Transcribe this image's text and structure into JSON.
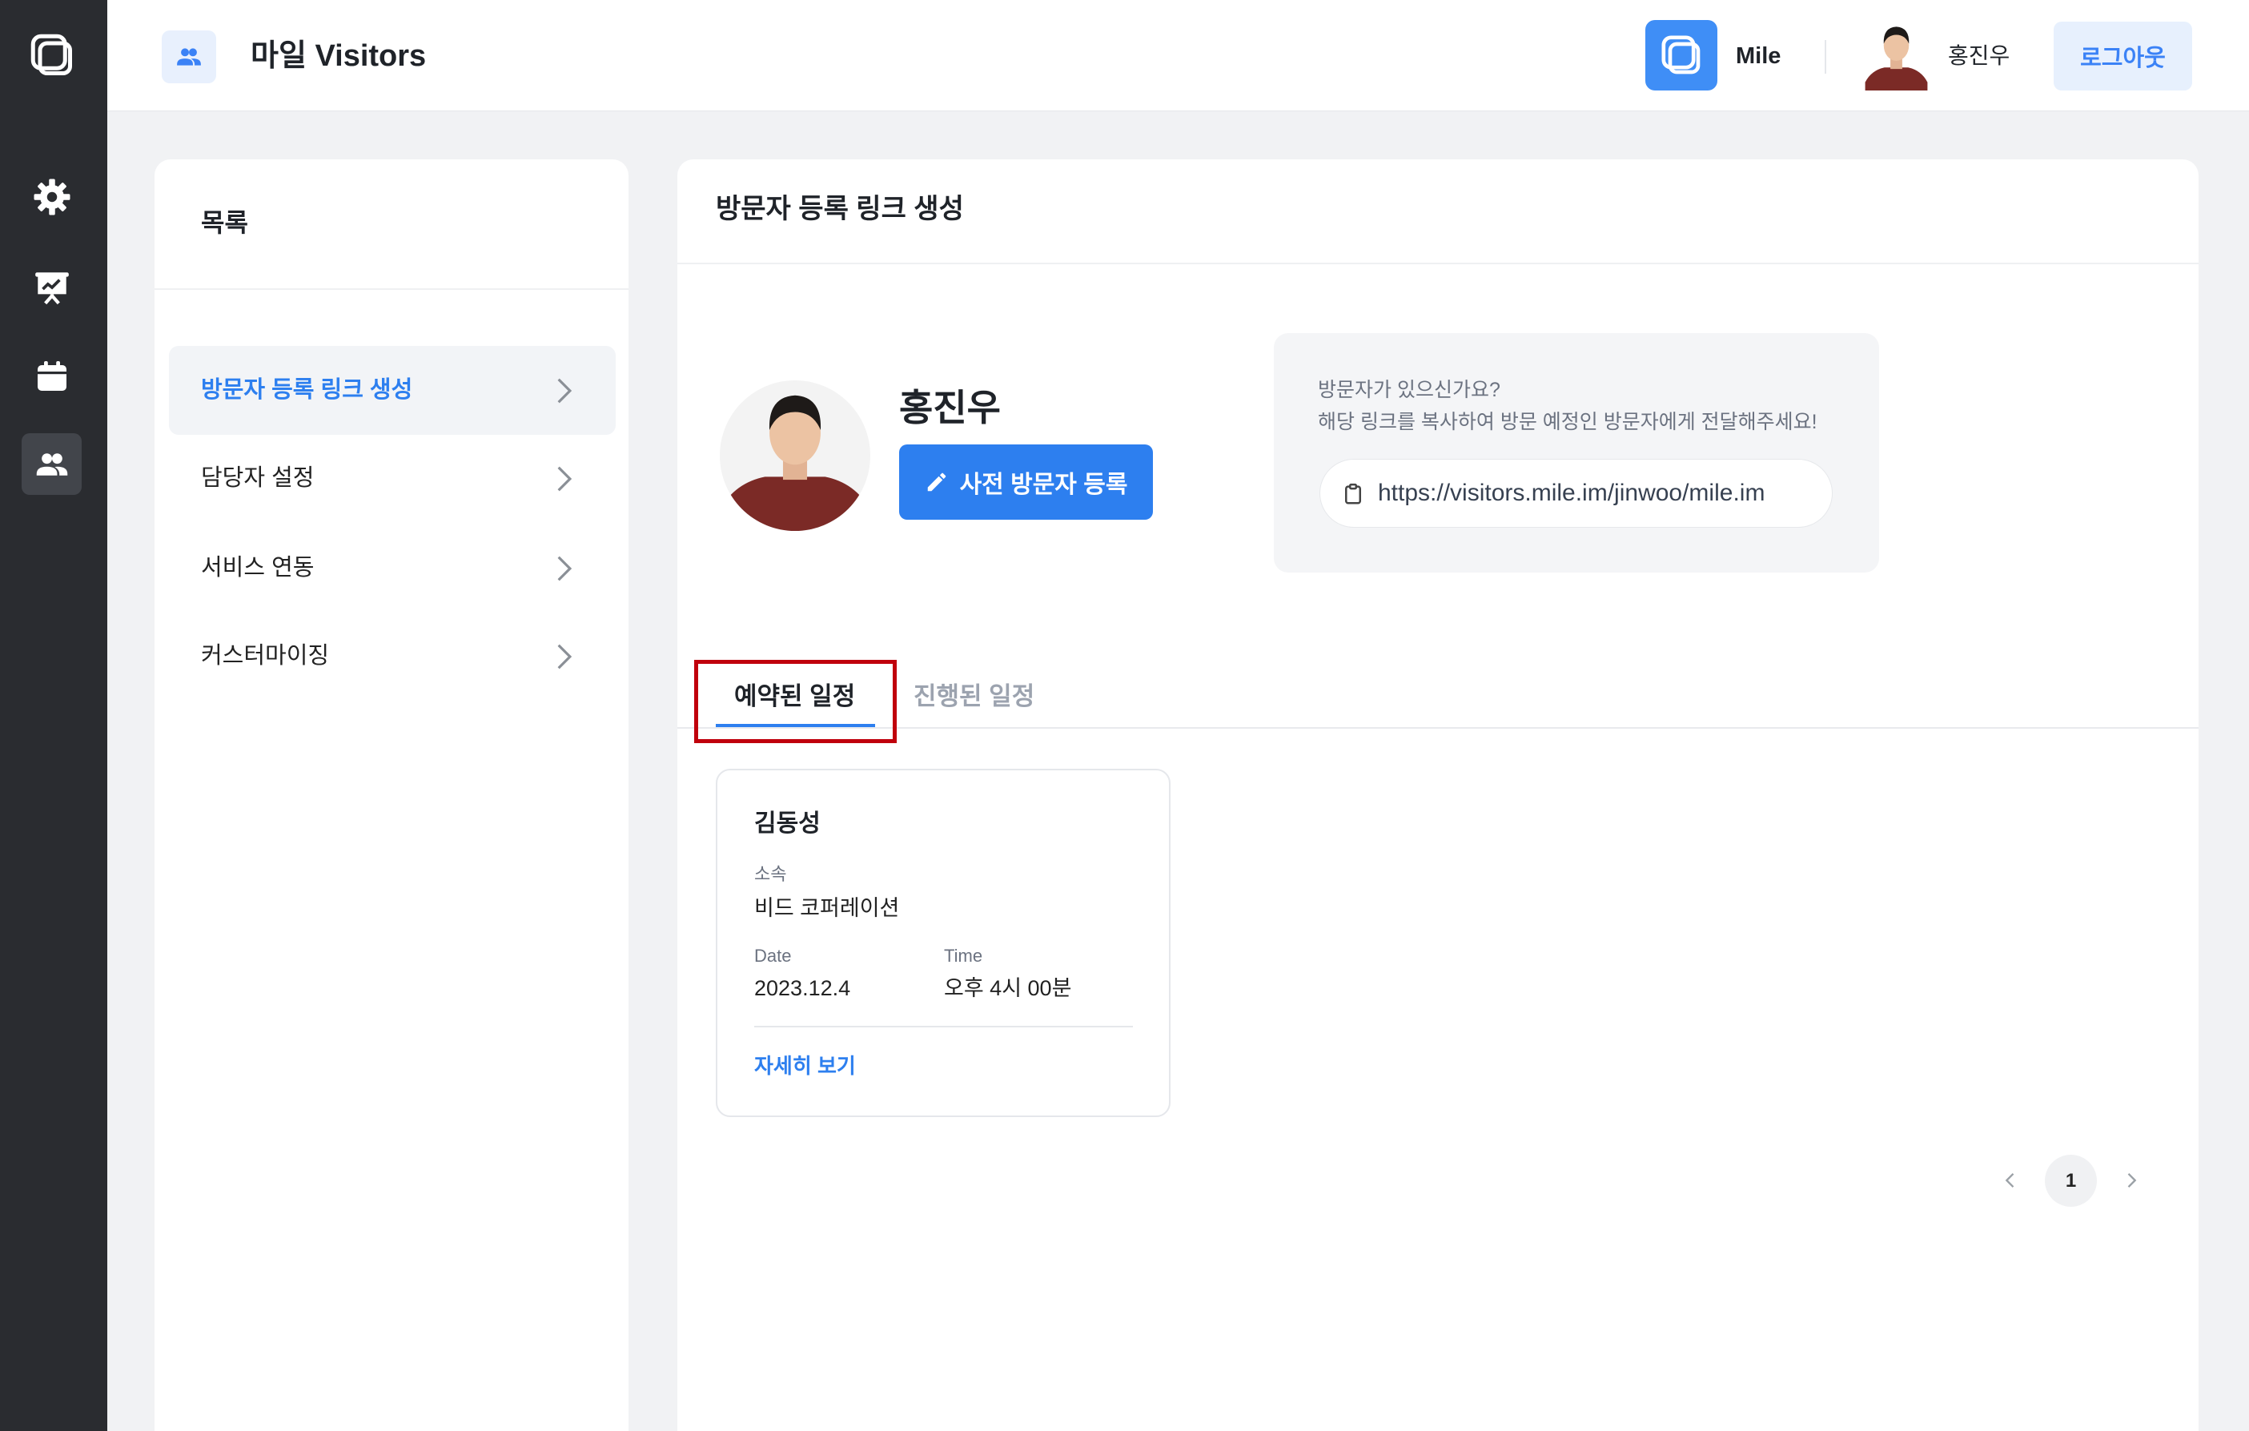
{
  "colors": {
    "accent": "#2d7fef",
    "rail_background": "#2a2c30",
    "page_background": "#f1f2f4",
    "annotation_border": "#c0000c"
  },
  "rail": {
    "items": [
      {
        "icon": "logo-icon"
      },
      {
        "icon": "gear-icon"
      },
      {
        "icon": "presentation-icon"
      },
      {
        "icon": "calendar-icon"
      },
      {
        "icon": "users-icon",
        "active": true
      }
    ]
  },
  "header": {
    "app_icon": "users-icon",
    "title": "마일 Visitors",
    "brand_name": "Mile",
    "user_name": "홍진우",
    "logout_label": "로그아웃"
  },
  "menu": {
    "title": "목록",
    "items": [
      {
        "label": "방문자 등록 링크 생성",
        "active": true,
        "icon": "chevron-right-icon"
      },
      {
        "label": "담당자 설정",
        "active": false,
        "icon": "chevron-right-icon"
      },
      {
        "label": "서비스 연동",
        "active": false,
        "icon": "chevron-right-icon"
      },
      {
        "label": "커스터마이징",
        "active": false,
        "icon": "chevron-right-icon"
      }
    ]
  },
  "main": {
    "title": "방문자 등록 링크 생성",
    "profile": {
      "name": "홍진우",
      "register_button": "사전 방문자 등록",
      "register_icon": "pencil-icon"
    },
    "invite": {
      "question": "방문자가 있으신가요?",
      "instruction": "해당 링크를 복사하여 방문 예정인 방문자에게 전달해주세요!",
      "link_icon": "clipboard-icon",
      "link": "https://visitors.mile.im/jinwoo/mile.im"
    },
    "tabs": [
      {
        "label": "예약된 일정",
        "active": true
      },
      {
        "label": "진행된 일정",
        "active": false
      }
    ],
    "cards": [
      {
        "name": "김동성",
        "affiliation_label": "소속",
        "affiliation": "비드 코퍼레이션",
        "date_label": "Date",
        "date": "2023.12.4",
        "time_label": "Time",
        "time": "오후 4시 00분",
        "detail_link": "자세히 보기"
      }
    ],
    "pagination": {
      "current": "1",
      "prev_icon": "chevron-left-icon",
      "next_icon": "chevron-right-icon"
    }
  }
}
